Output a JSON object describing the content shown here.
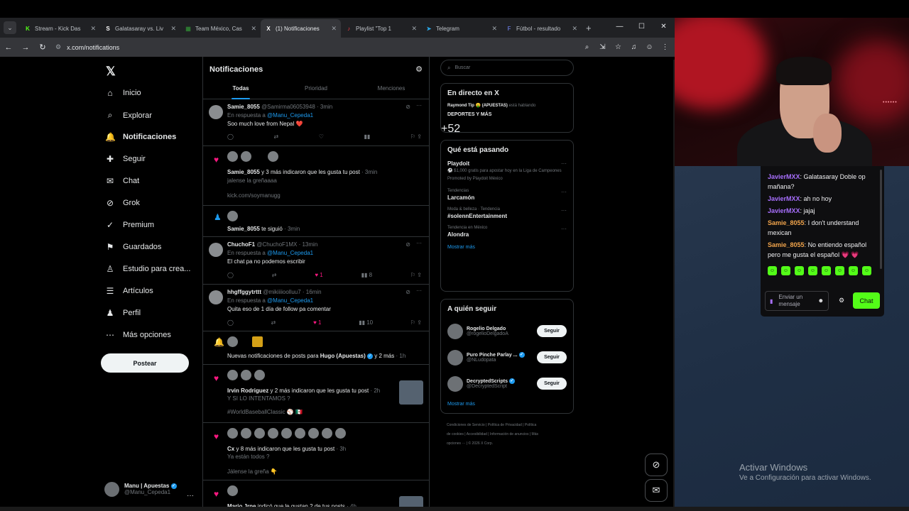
{
  "browser": {
    "tabs": [
      {
        "label": "Stream - Kick Das",
        "icon": "K",
        "color": "#53fc18"
      },
      {
        "label": "Galatasaray vs. Liv",
        "icon": "S",
        "color": "#ffffff"
      },
      {
        "label": "Team México, Cas",
        "icon": "▦",
        "color": "#2e7d32"
      },
      {
        "label": "(1) Notificaciones",
        "icon": "X",
        "color": "#ffffff"
      },
      {
        "label": "Playlist \"Top 1",
        "icon": "♪",
        "color": "#fc3c44"
      },
      {
        "label": "Telegram",
        "icon": "➤",
        "color": "#29a9eb"
      },
      {
        "label": "Fútbol - resultado",
        "icon": "F",
        "color": "#5c6bc0"
      }
    ],
    "url": "x.com/notifications"
  },
  "nav": {
    "items": [
      {
        "label": "Inicio",
        "icon": "⌂"
      },
      {
        "label": "Explorar",
        "icon": "⌕"
      },
      {
        "label": "Notificaciones",
        "icon": "🔔"
      },
      {
        "label": "Seguir",
        "icon": "✚"
      },
      {
        "label": "Chat",
        "icon": "✉"
      },
      {
        "label": "Grok",
        "icon": "⊘"
      },
      {
        "label": "Premium",
        "icon": "✓"
      },
      {
        "label": "Guardados",
        "icon": "⚑"
      },
      {
        "label": "Estudio para crea...",
        "icon": "♙"
      },
      {
        "label": "Artículos",
        "icon": "☰"
      },
      {
        "label": "Perfil",
        "icon": "♟"
      },
      {
        "label": "Más opciones",
        "icon": "⋯"
      }
    ],
    "post_label": "Postear",
    "account_name": "Manu | Apuestas",
    "account_handle": "@Manu_Cepeda1"
  },
  "main": {
    "title": "Notificaciones",
    "tabs": [
      "Todas",
      "Prioridad",
      "Menciones"
    ],
    "n1": {
      "name": "Samie_8055",
      "handle": "@Samirma06053948 · 3min",
      "reply_prefix": "En respuesta a",
      "reply_to": "@Manu_Cepeda1",
      "text": "Soo much love from Nepal ❤️"
    },
    "n2": {
      "name": "Samie_8055",
      "rest": "y 3 más indicaron que les gusta tu post",
      "time": "· 3min",
      "quote": "jalense la greñaaaa",
      "link": "kick.com/soymanugg"
    },
    "n3": {
      "name": "Samie_8055",
      "rest": "te siguió",
      "time": "· 3min"
    },
    "n4": {
      "name": "ChuchoF1",
      "handle": "@ChuchoF1MX · 13min",
      "reply_prefix": "En respuesta a",
      "reply_to": "@Manu_Cepeda1",
      "text": "El chat pa no podemos escribir",
      "likes": "1",
      "views": "8"
    },
    "n5": {
      "name": "hhgffggytrttt",
      "handle": "@mikiiiioolluu7 · 16min",
      "reply_prefix": "En respuesta a",
      "reply_to": "@Manu_Cepeda1",
      "text": "Quita eso de 1 día de follow pa comentar",
      "likes": "1",
      "views": "10"
    },
    "n6": {
      "prefix": "Nuevas notificaciones de posts para",
      "name": "Hugo (Apuestas)",
      "rest": "y 2 más",
      "time": "· 1h"
    },
    "n7": {
      "name": "Irvin Rodriguez",
      "rest": "y 2 más indicaron que les gusta tu post",
      "time": "· 2h",
      "quote": "Y SI LO INTENTAMOS ?",
      "tag": "#WorldBaseballClassic ⚾ 🇲🇽"
    },
    "n8": {
      "name": "Cx",
      "rest": "y 8 más indicaron que les gusta tu post",
      "time": "· 3h",
      "quote": "Ya están todos ?",
      "quote2": "Jálense la greña 👇"
    },
    "n9": {
      "name": "Mario Jrpe",
      "rest": "indicó que le gustan 2 de tus posts",
      "time": "· 4h"
    }
  },
  "right": {
    "search_placeholder": "Buscar",
    "live_title": "En directo en X",
    "live_host": "Raymond Tip 🤑 (APUESTAS)",
    "live_status": "está hablando",
    "live_topic": "DEPORTES Y MÁS",
    "live_count": "+52",
    "trends_title": "Qué está pasando",
    "trends": [
      {
        "cat": "",
        "name": "Playdoit",
        "desc": "⚽ $1,000 gratis para apostar hoy en la Liga de Campeones",
        "promo": "Promoted by Playdoit México"
      },
      {
        "cat": "Tendencias",
        "name": "Larcamón",
        "desc": "",
        "promo": ""
      },
      {
        "cat": "Moda & belleza · Tendencia",
        "name": "#solennEntertainment",
        "desc": "",
        "promo": ""
      },
      {
        "cat": "Tendencia en México",
        "name": "Alondra",
        "desc": "",
        "promo": ""
      }
    ],
    "show_more": "Mostrar más",
    "follow_title": "A quién seguir",
    "follow": [
      {
        "name": "Rogelio Delgado",
        "handle": "@rogelioDelgadoA",
        "verified": false
      },
      {
        "name": "Puro Pinche Parlay ...",
        "handle": "@NLudopata",
        "verified": true
      },
      {
        "name": "DecryptedScripts",
        "handle": "@DecryptedScript",
        "verified": true
      }
    ],
    "follow_btn": "Seguir",
    "footer_links": [
      "Condiciones de Servicio",
      "Política de Privacidad",
      "Política de cookies",
      "Accesibilidad",
      "Información de anuncios",
      "Más opciones ···",
      "© 2026 X Corp."
    ]
  },
  "chat": {
    "messages": [
      {
        "user": "JavierMXX",
        "text": "Galatasaray Doble op mañana?",
        "color": "u1"
      },
      {
        "user": "JavierMXX",
        "text": "ah no hoy",
        "color": "u1"
      },
      {
        "user": "JavierMXX",
        "text": "jajaj",
        "color": "u1"
      },
      {
        "user": "Samie_8055",
        "text": "I don't understand mexican",
        "color": "u2"
      },
      {
        "user": "Samie_8055",
        "text": "No entiendo español pero me gusta el español 💗 💗",
        "color": "u2"
      }
    ],
    "input_placeholder": "Enviar un mensaje",
    "send_label": "Chat"
  },
  "windows": {
    "line1": "Activar Windows",
    "line2": "Ve a Configuración para activar Windows."
  }
}
